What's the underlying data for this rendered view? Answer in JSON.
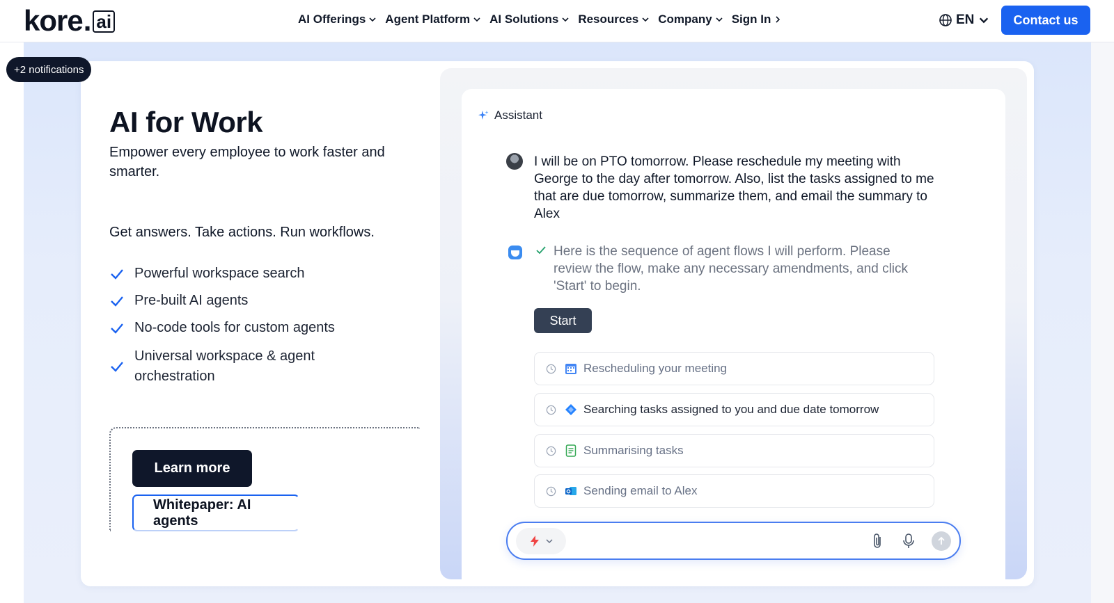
{
  "header": {
    "logo_text": "kore",
    "logo_dot": ".",
    "logo_ai": "ai",
    "nav": [
      {
        "label": "AI Offerings",
        "icon": "chevron-down-icon"
      },
      {
        "label": "Agent Platform",
        "icon": "chevron-down-icon"
      },
      {
        "label": "AI Solutions",
        "icon": "chevron-down-icon"
      },
      {
        "label": "Resources",
        "icon": "chevron-down-icon"
      },
      {
        "label": "Company",
        "icon": "chevron-down-icon"
      },
      {
        "label": "Sign In",
        "icon": "chevron-right-icon"
      }
    ],
    "language": "EN",
    "contact_label": "Contact us"
  },
  "notifications_label": "+2 notifications",
  "hero": {
    "title": "AI for Work",
    "subtitle": "Empower every employee to work faster and smarter.",
    "tagline": "Get answers. Take actions. Run workflows.",
    "features": [
      "Powerful workspace search",
      "Pre-built AI agents",
      "No-code tools for custom agents",
      "Universal workspace & agent orchestration"
    ],
    "learn_more_label": "Learn more",
    "whitepaper_label": "Whitepaper: AI agents"
  },
  "assistant": {
    "label": "Assistant",
    "user_message": "I will be on PTO tomorrow. Please reschedule my meeting with George to the day after tomorrow. Also, list the tasks assigned to me that are due tomorrow, summarize them, and email the summary to Alex",
    "bot_message": "Here is the sequence of agent flows I will perform. Please review the flow, make any necessary amendments, and click 'Start' to begin.",
    "start_label": "Start",
    "flows": [
      {
        "label": "Rescheduling your meeting",
        "icon": "calendar-icon"
      },
      {
        "label": "Searching tasks assigned to you and due date tomorrow",
        "icon": "diamond-icon"
      },
      {
        "label": "Summarising tasks",
        "icon": "document-icon"
      },
      {
        "label": "Sending email to Alex",
        "icon": "outlook-icon"
      }
    ],
    "composer": {
      "placeholder": ""
    }
  },
  "colors": {
    "accent": "#1a62f0",
    "dark": "#0f172a",
    "check": "#1a62f0"
  }
}
